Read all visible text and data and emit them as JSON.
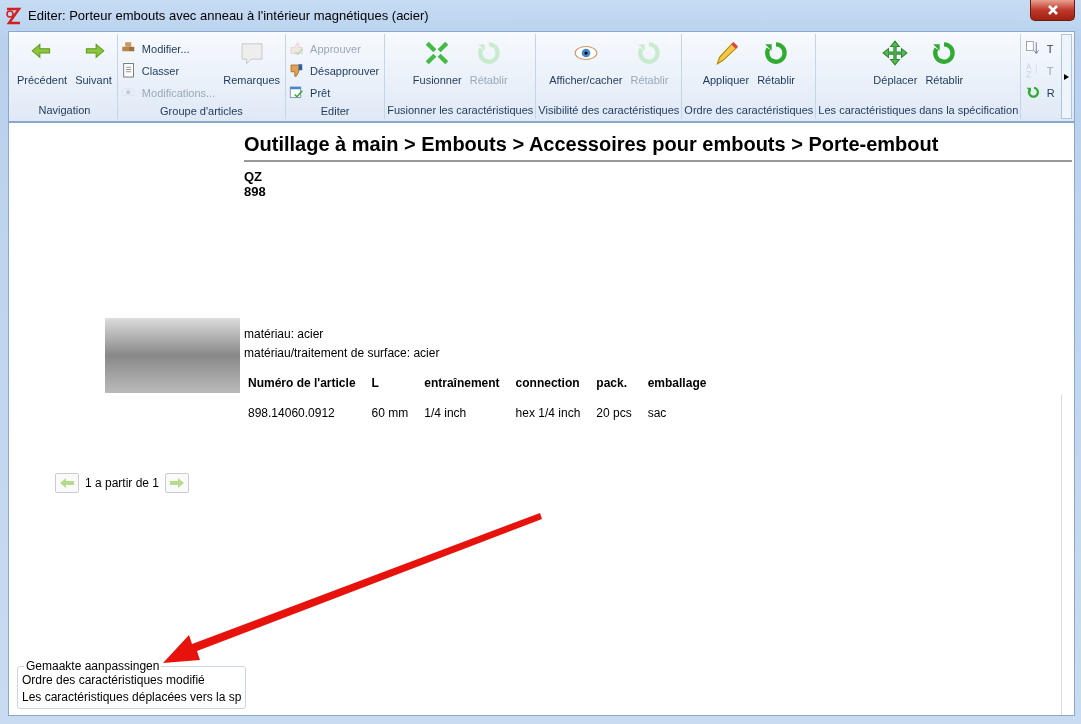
{
  "window": {
    "title": "Editer: Porteur embouts avec anneau à l'intérieur magnétiques (acier)"
  },
  "ribbon": {
    "groups": [
      {
        "label": "Navigation",
        "items": [
          {
            "label": "Précédent",
            "kind": "large",
            "disabled": false
          },
          {
            "label": "Suivant",
            "kind": "large",
            "disabled": false
          }
        ]
      },
      {
        "label": "Groupe d'articles",
        "items": [
          {
            "label": "Modifier...",
            "kind": "small",
            "disabled": false
          },
          {
            "label": "Classer",
            "kind": "small",
            "disabled": false
          },
          {
            "label": "Modifications...",
            "kind": "small",
            "disabled": true
          },
          {
            "label": "Remarques",
            "kind": "large",
            "disabled": false
          }
        ]
      },
      {
        "label": "Editer",
        "items": [
          {
            "label": "Approuver",
            "kind": "small",
            "disabled": true
          },
          {
            "label": "Désapprouver",
            "kind": "small",
            "disabled": false
          },
          {
            "label": "Prêt",
            "kind": "small",
            "disabled": false
          }
        ]
      },
      {
        "label": "Fusionner les caractéristiques",
        "items": [
          {
            "label": "Fusionner",
            "kind": "large",
            "disabled": false
          },
          {
            "label": "Rétablir",
            "kind": "large",
            "disabled": true
          }
        ]
      },
      {
        "label": "Visibilité des caractéristiques",
        "items": [
          {
            "label": "Afficher/cacher",
            "kind": "large",
            "disabled": false
          },
          {
            "label": "Rétablir",
            "kind": "large",
            "disabled": true
          }
        ]
      },
      {
        "label": "Ordre des caractéristiques",
        "items": [
          {
            "label": "Appliquer",
            "kind": "large",
            "disabled": false
          },
          {
            "label": "Rétablir",
            "kind": "large",
            "disabled": false
          }
        ]
      },
      {
        "label": "Les caractéristiques dans la spécification",
        "items": [
          {
            "label": "Déplacer",
            "kind": "large",
            "disabled": false
          },
          {
            "label": "Rétablir",
            "kind": "large",
            "disabled": false
          }
        ]
      },
      {
        "items": [
          {
            "label": "T",
            "kind": "small",
            "disabled": false
          },
          {
            "label": "T",
            "kind": "small",
            "disabled": true
          },
          {
            "label": "R",
            "kind": "small",
            "disabled": false
          }
        ]
      }
    ]
  },
  "content": {
    "breadcrumb": "Outillage à main > Embouts > Accessoires pour embouts > Porte-embout",
    "brand": "QZ",
    "number": "898",
    "attributes": [
      "matériau: acier",
      "matériau/traitement de surface: acier"
    ],
    "table": {
      "columns": [
        "Numéro de l'article",
        "L",
        "entraînement",
        "connection",
        "pack.",
        "emballage"
      ],
      "rows": [
        [
          "898.14060.0912",
          "60 mm",
          "1/4 inch",
          "hex 1/4 inch",
          "20 pcs",
          "sac"
        ]
      ]
    },
    "pager": "1 a partir de 1"
  },
  "changes": {
    "legend": "Gemaakte aanpassingen",
    "items": [
      "Ordre des caractéristiques modifié",
      "Les caractéristiques déplacées vers la sp"
    ]
  }
}
